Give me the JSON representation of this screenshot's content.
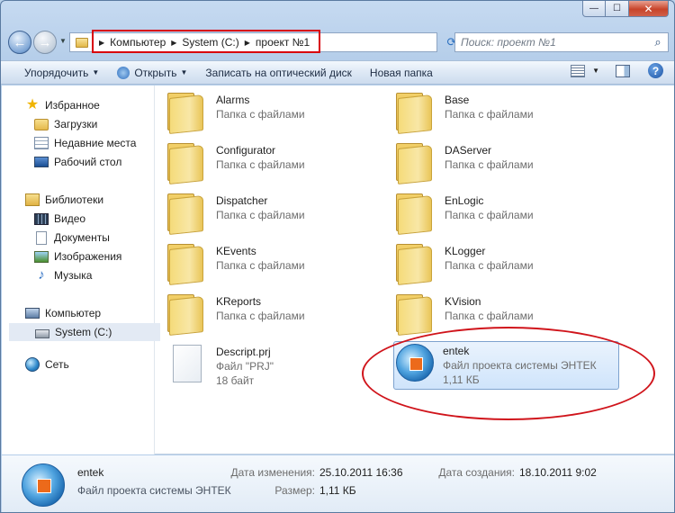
{
  "window": {
    "caption_buttons": {
      "minimize": "—",
      "maximize": "☐",
      "close": "✕"
    }
  },
  "address": {
    "crumbs": [
      "Компьютер",
      "System (C:)",
      "проект №1"
    ],
    "search_placeholder": "Поиск: проект №1"
  },
  "toolbar": {
    "organize": "Упорядочить",
    "open": "Открыть",
    "burn": "Записать на оптический диск",
    "new_folder": "Новая папка"
  },
  "nav": {
    "favorites": "Избранное",
    "downloads": "Загрузки",
    "recent": "Недавние места",
    "desktop": "Рабочий стол",
    "libraries": "Библиотеки",
    "video": "Видео",
    "documents": "Документы",
    "images": "Изображения",
    "music": "Музыка",
    "computer": "Компьютер",
    "system_c": "System (C:)",
    "network": "Сеть"
  },
  "files": [
    {
      "name": "Alarms",
      "type": "Папка с файлами"
    },
    {
      "name": "Base",
      "type": "Папка с файлами"
    },
    {
      "name": "Configurator",
      "type": "Папка с файлами"
    },
    {
      "name": "DAServer",
      "type": "Папка с файлами"
    },
    {
      "name": "Dispatcher",
      "type": "Папка с файлами"
    },
    {
      "name": "EnLogic",
      "type": "Папка с файлами"
    },
    {
      "name": "KEvents",
      "type": "Папка с файлами"
    },
    {
      "name": "KLogger",
      "type": "Папка с файлами"
    },
    {
      "name": "KReports",
      "type": "Папка с файлами"
    },
    {
      "name": "KVision",
      "type": "Папка с файлами"
    },
    {
      "name": "Descript.prj",
      "type": "Файл \"PRJ\"",
      "size": "18 байт"
    },
    {
      "name": "entek",
      "type": "Файл проекта системы ЭНТЕК",
      "size": "1,11 КБ"
    }
  ],
  "details": {
    "name": "entek",
    "type": "Файл проекта системы ЭНТЕК",
    "modified_label": "Дата изменения:",
    "modified_value": "25.10.2011 16:36",
    "created_label": "Дата создания:",
    "created_value": "18.10.2011 9:02",
    "size_label": "Размер:",
    "size_value": "1,11 КБ"
  }
}
